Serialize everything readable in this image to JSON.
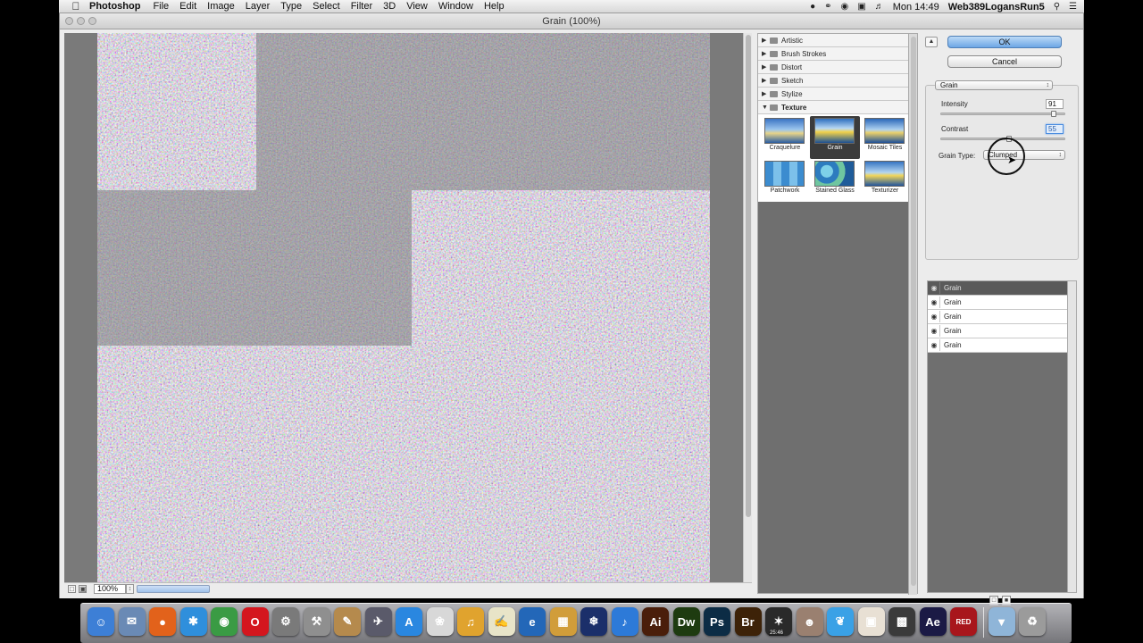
{
  "menubar": {
    "app_name": "Photoshop",
    "items": [
      "File",
      "Edit",
      "Image",
      "Layer",
      "Type",
      "Select",
      "Filter",
      "3D",
      "View",
      "Window",
      "Help"
    ],
    "clock": "Mon 14:49",
    "user": "Web389LogansRun5"
  },
  "window": {
    "title": "Grain (100%)"
  },
  "preview": {
    "zoom": "100%",
    "stepper_glyph": "↕",
    "grow_glyph": "□",
    "shrink_glyph": "▣"
  },
  "gallery": {
    "categories": [
      {
        "label": "Artistic",
        "expanded": false
      },
      {
        "label": "Brush Strokes",
        "expanded": false
      },
      {
        "label": "Distort",
        "expanded": false
      },
      {
        "label": "Sketch",
        "expanded": false
      },
      {
        "label": "Stylize",
        "expanded": false
      },
      {
        "label": "Texture",
        "expanded": true
      }
    ],
    "collapsed_arrow": "▶",
    "expanded_arrow": "▼",
    "thumbnails": [
      {
        "label": "Craquelure",
        "selected": false
      },
      {
        "label": "Grain",
        "selected": true
      },
      {
        "label": "Mosaic Tiles",
        "selected": false
      },
      {
        "label": "Patchwork",
        "selected": false
      },
      {
        "label": "Stained Glass",
        "selected": false
      },
      {
        "label": "Texturizer",
        "selected": false
      }
    ]
  },
  "settings": {
    "collapse_glyph": "▲",
    "ok_label": "OK",
    "cancel_label": "Cancel",
    "filter_select": "Grain",
    "intensity": {
      "label": "Intensity",
      "value": "91",
      "level": 91
    },
    "contrast": {
      "label": "Contrast",
      "value": "55",
      "level": 55
    },
    "grain_type": {
      "label": "Grain Type:",
      "value": "Clumped"
    },
    "chevron": "↕"
  },
  "layers": {
    "items": [
      {
        "label": "Grain",
        "active": true
      },
      {
        "label": "Grain",
        "active": false
      },
      {
        "label": "Grain",
        "active": false
      },
      {
        "label": "Grain",
        "active": false
      },
      {
        "label": "Grain",
        "active": false
      }
    ],
    "eye_glyph": "◉",
    "new_glyph": "□",
    "delete_glyph": "■"
  },
  "dock": {
    "icons": [
      {
        "name": "finder-icon",
        "text": "☺",
        "color": "#3d7fd6"
      },
      {
        "name": "preview-icon",
        "text": "✉",
        "color": "#6a8ab5"
      },
      {
        "name": "firefox-icon",
        "text": "●",
        "color": "#e2621b"
      },
      {
        "name": "safari-icon",
        "text": "✱",
        "color": "#2f8fdc"
      },
      {
        "name": "chrome-icon",
        "text": "◉",
        "color": "#3a9b44"
      },
      {
        "name": "opera-icon",
        "text": "O",
        "color": "#d4161e"
      },
      {
        "name": "system-preferences-icon",
        "text": "⚙",
        "color": "#7a7a7a"
      },
      {
        "name": "utilities-icon",
        "text": "⚒",
        "color": "#8f8f8f"
      },
      {
        "name": "textedit-icon",
        "text": "✎",
        "color": "#b58a4d"
      },
      {
        "name": "launchpad-icon",
        "text": "✈",
        "color": "#5a5a6a"
      },
      {
        "name": "app-store-icon",
        "text": "A",
        "color": "#2a87e0"
      },
      {
        "name": "photos-icon",
        "text": "❀",
        "color": "#d8d8d8"
      },
      {
        "name": "garageband-icon",
        "text": "♫",
        "color": "#e0a32e"
      },
      {
        "name": "notes-icon",
        "text": "✍",
        "color": "#e8e4c8"
      },
      {
        "name": "browser-icon",
        "text": "e",
        "color": "#2367b8"
      },
      {
        "name": "puzzle-icon",
        "text": "▦",
        "color": "#d19d3a"
      },
      {
        "name": "snowflake-icon",
        "text": "❄",
        "color": "#1b2f6a"
      },
      {
        "name": "itunes-icon",
        "text": "♪",
        "color": "#2d7ad8"
      },
      {
        "name": "illustrator-icon",
        "text": "Ai",
        "color": "#4a1e0a"
      },
      {
        "name": "dreamweaver-icon",
        "text": "Dw",
        "color": "#1e3b10"
      },
      {
        "name": "photoshop-icon",
        "text": "Ps",
        "color": "#0c2c45"
      },
      {
        "name": "bridge-icon",
        "text": "Br",
        "color": "#3d2208"
      },
      {
        "name": "acrobat-icon",
        "text": "✶",
        "color": "#2a2a2a"
      },
      {
        "name": "photo-booth-icon",
        "text": "☻",
        "color": "#9a8070"
      },
      {
        "name": "twitter-icon",
        "text": "❦",
        "color": "#3aa1e6"
      },
      {
        "name": "instagram-icon",
        "text": "▣",
        "color": "#e8e0d4"
      },
      {
        "name": "cubes-icon",
        "text": "▩",
        "color": "#3a3a3a"
      },
      {
        "name": "after-effects-icon",
        "text": "Ae",
        "color": "#1b1a45"
      },
      {
        "name": "red-giant-link-icon",
        "text": "RED",
        "color": "#a8161c"
      },
      {
        "name": "downloads-folder-icon",
        "text": "▼",
        "color": "#8fb5d8"
      },
      {
        "name": "trash-icon",
        "text": "♻",
        "color": "#9b9b9b"
      }
    ],
    "badge": "25:46"
  }
}
